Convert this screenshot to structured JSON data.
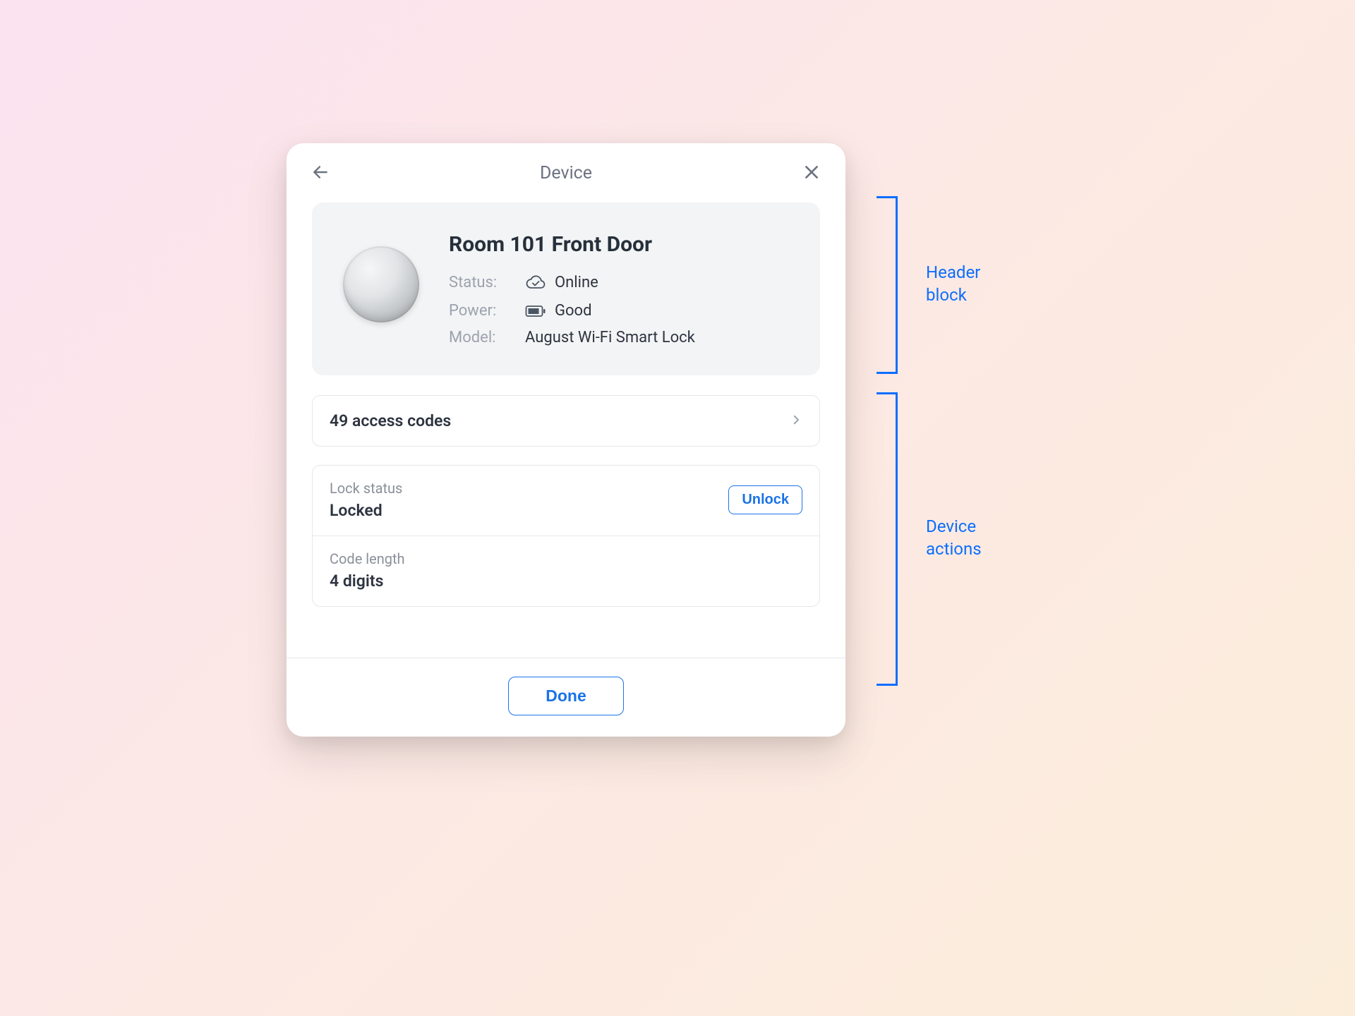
{
  "header": {
    "title": "Device"
  },
  "device": {
    "name": "Room 101 Front Door",
    "status_label": "Status:",
    "status_value": "Online",
    "power_label": "Power:",
    "power_value": "Good",
    "model_label": "Model:",
    "model_value": "August Wi-Fi Smart Lock"
  },
  "access_codes": {
    "label": "49 access codes"
  },
  "lock": {
    "label": "Lock status",
    "value": "Locked",
    "action_label": "Unlock"
  },
  "code_length": {
    "label": "Code length",
    "value": "4 digits"
  },
  "footer": {
    "done_label": "Done"
  },
  "annotations": {
    "header_block": "Header\nblock",
    "device_actions": "Device\nactions"
  },
  "colors": {
    "accent": "#1a73e8",
    "annotation": "#0d6efd"
  }
}
